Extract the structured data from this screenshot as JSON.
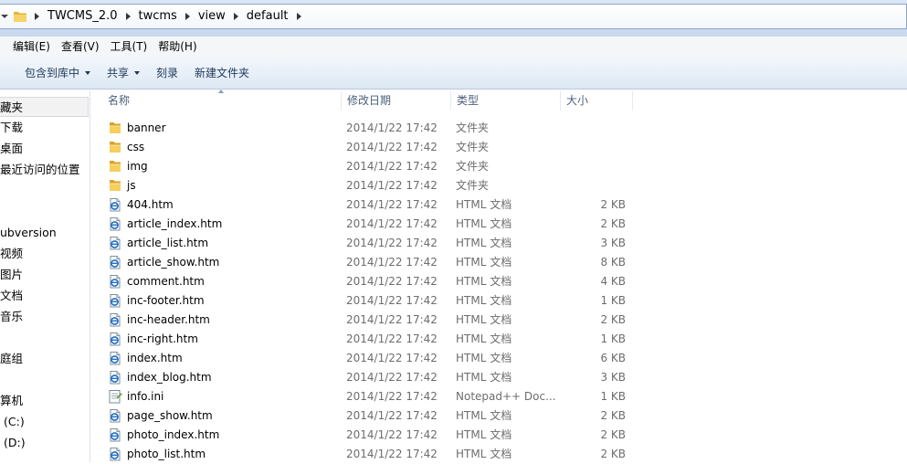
{
  "address": {
    "crumbs": [
      "TWCMS_2.0",
      "twcms",
      "view",
      "default"
    ]
  },
  "menubar": {
    "items": [
      "编辑(E)",
      "查看(V)",
      "工具(T)",
      "帮助(H)"
    ]
  },
  "toolbar": {
    "include_library": "包含到库中",
    "share": "共享",
    "burn": "刻录",
    "new_folder": "新建文件夹"
  },
  "nav": {
    "items": [
      "藏夹",
      "下载",
      "桌面",
      "最近访问的位置",
      "ubversion",
      "视频",
      "图片",
      "文档",
      "音乐",
      "庭组",
      "算机",
      "(C:)",
      "(D:)"
    ]
  },
  "columns": {
    "name": "名称",
    "modified": "修改日期",
    "type": "类型",
    "size": "大小"
  },
  "files": [
    {
      "name": "banner",
      "date": "2014/1/22 17:42",
      "type": "文件夹",
      "size": "",
      "icon": "folder-icon"
    },
    {
      "name": "css",
      "date": "2014/1/22 17:42",
      "type": "文件夹",
      "size": "",
      "icon": "folder-icon"
    },
    {
      "name": "img",
      "date": "2014/1/22 17:42",
      "type": "文件夹",
      "size": "",
      "icon": "folder-icon"
    },
    {
      "name": "js",
      "date": "2014/1/22 17:42",
      "type": "文件夹",
      "size": "",
      "icon": "folder-icon"
    },
    {
      "name": "404.htm",
      "date": "2014/1/22 17:42",
      "type": "HTML 文档",
      "size": "2 KB",
      "icon": "html-file-icon"
    },
    {
      "name": "article_index.htm",
      "date": "2014/1/22 17:42",
      "type": "HTML 文档",
      "size": "2 KB",
      "icon": "html-file-icon"
    },
    {
      "name": "article_list.htm",
      "date": "2014/1/22 17:42",
      "type": "HTML 文档",
      "size": "3 KB",
      "icon": "html-file-icon"
    },
    {
      "name": "article_show.htm",
      "date": "2014/1/22 17:42",
      "type": "HTML 文档",
      "size": "8 KB",
      "icon": "html-file-icon"
    },
    {
      "name": "comment.htm",
      "date": "2014/1/22 17:42",
      "type": "HTML 文档",
      "size": "4 KB",
      "icon": "html-file-icon"
    },
    {
      "name": "inc-footer.htm",
      "date": "2014/1/22 17:42",
      "type": "HTML 文档",
      "size": "1 KB",
      "icon": "html-file-icon"
    },
    {
      "name": "inc-header.htm",
      "date": "2014/1/22 17:42",
      "type": "HTML 文档",
      "size": "2 KB",
      "icon": "html-file-icon"
    },
    {
      "name": "inc-right.htm",
      "date": "2014/1/22 17:42",
      "type": "HTML 文档",
      "size": "1 KB",
      "icon": "html-file-icon"
    },
    {
      "name": "index.htm",
      "date": "2014/1/22 17:42",
      "type": "HTML 文档",
      "size": "6 KB",
      "icon": "html-file-icon"
    },
    {
      "name": "index_blog.htm",
      "date": "2014/1/22 17:42",
      "type": "HTML 文档",
      "size": "3 KB",
      "icon": "html-file-icon"
    },
    {
      "name": "info.ini",
      "date": "2014/1/22 17:42",
      "type": "Notepad++ Doc...",
      "size": "1 KB",
      "icon": "notepad-file-icon"
    },
    {
      "name": "page_show.htm",
      "date": "2014/1/22 17:42",
      "type": "HTML 文档",
      "size": "2 KB",
      "icon": "html-file-icon"
    },
    {
      "name": "photo_index.htm",
      "date": "2014/1/22 17:42",
      "type": "HTML 文档",
      "size": "2 KB",
      "icon": "html-file-icon"
    },
    {
      "name": "photo_list.htm",
      "date": "2014/1/22 17:42",
      "type": "HTML 文档",
      "size": "2 KB",
      "icon": "html-file-icon"
    }
  ]
}
